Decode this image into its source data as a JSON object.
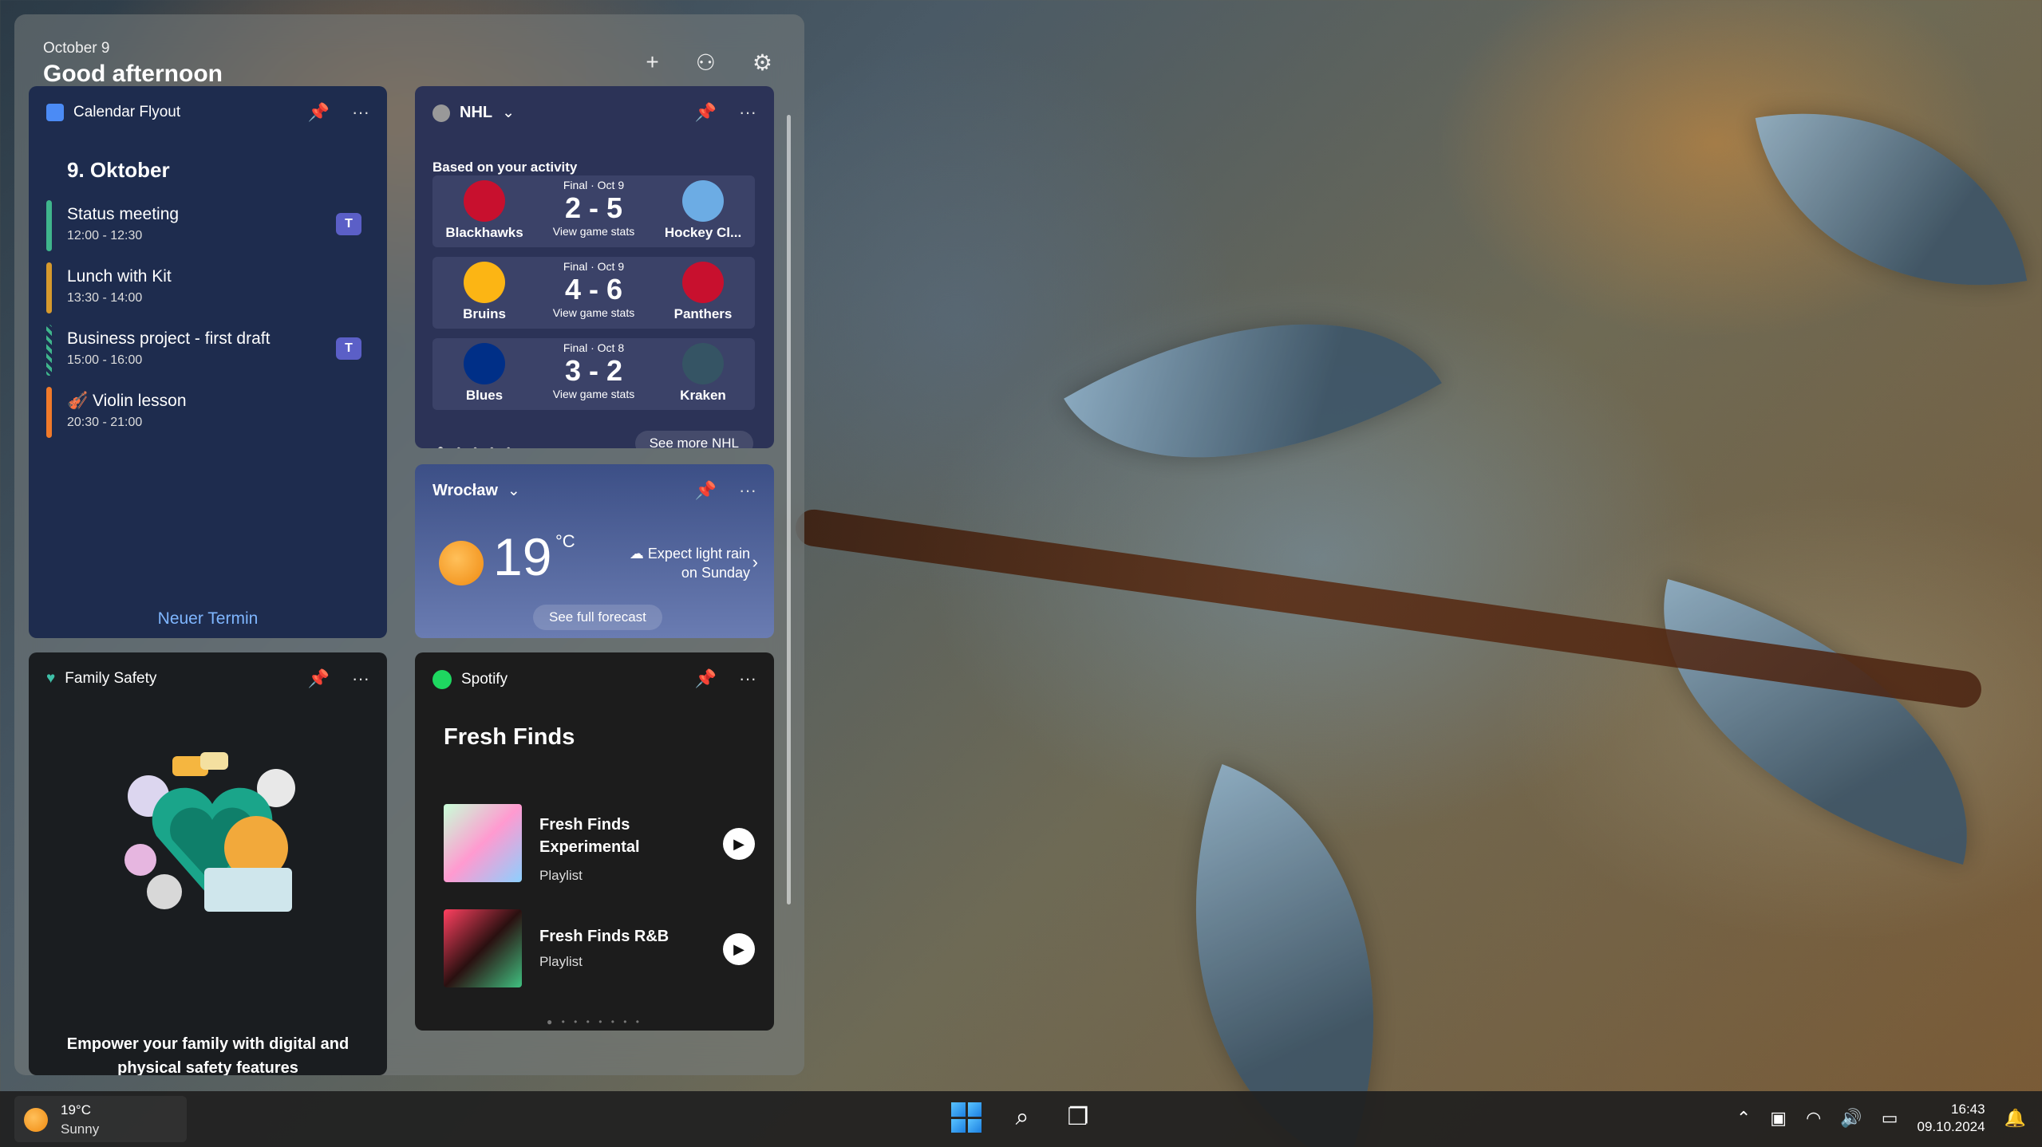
{
  "board": {
    "date": "October 9",
    "greeting": "Good afternoon",
    "actions": {
      "add": "+",
      "people": "⚇",
      "settings": "⚙"
    }
  },
  "calendar": {
    "app_name": "Calendar Flyout",
    "date_title": "9. Oktober",
    "events": [
      {
        "name": "Status meeting",
        "time": "12:00 - 12:30",
        "color": "#3fb58c",
        "teams": true
      },
      {
        "name": "Lunch with Kit",
        "time": "13:30 - 14:00",
        "color": "#d69a2d",
        "teams": false
      },
      {
        "name": "Business project - first draft",
        "time": "15:00 - 16:00",
        "color": "#3fb58c",
        "teams": true
      },
      {
        "name": "Violin lesson",
        "time": "20:30 - 21:00",
        "color": "#f07a2a",
        "teams": false
      }
    ],
    "new_event": "Neuer Termin"
  },
  "nhl": {
    "title": "NHL",
    "subtitle": "Based on your activity",
    "games": [
      {
        "status": "Final · Oct 9",
        "score": "2 - 5",
        "stats": "View game stats",
        "home": "Blackhawks",
        "away": "Hockey Cl...",
        "home_color": "#c8102e",
        "away_color": "#6cace4"
      },
      {
        "status": "Final · Oct 9",
        "score": "4 - 6",
        "stats": "View game stats",
        "home": "Bruins",
        "away": "Panthers",
        "home_color": "#fcb514",
        "away_color": "#c8102e"
      },
      {
        "status": "Final · Oct 8",
        "score": "3 - 2",
        "stats": "View game stats",
        "home": "Blues",
        "away": "Kraken",
        "home_color": "#002f87",
        "away_color": "#99d9d9"
      }
    ],
    "see_more": "See more NHL"
  },
  "weather": {
    "city": "Wrocław",
    "temp": "19",
    "unit": "°C",
    "note": "Expect light rain on Sunday",
    "button": "See full forecast"
  },
  "family": {
    "app_name": "Family Safety",
    "text": "Empower your family with digital and physical safety features"
  },
  "spotify": {
    "app_name": "Spotify",
    "title": "Fresh Finds",
    "playlists": [
      {
        "name": "Fresh Finds Experimental",
        "kind": "Playlist"
      },
      {
        "name": "Fresh Finds R&B",
        "kind": "Playlist"
      }
    ]
  },
  "taskbar": {
    "weather_temp": "19°C",
    "weather_cond": "Sunny",
    "time": "16:43",
    "date": "09.10.2024"
  }
}
